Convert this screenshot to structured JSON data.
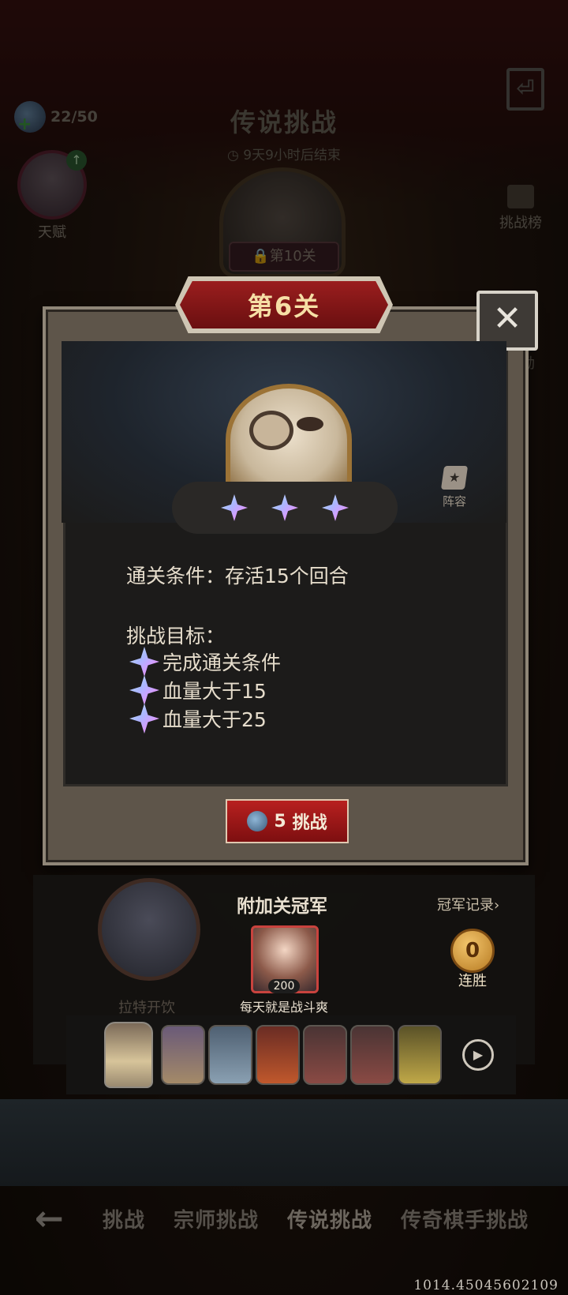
{
  "header": {
    "title": "传说挑战",
    "timer": "9天9小时后结束",
    "stamina": "22/50",
    "talent_label": "天赋",
    "side_menu": [
      "挑战榜",
      "奖励"
    ],
    "bg_stage_label": "第10关"
  },
  "modal": {
    "title": "第6关",
    "close_icon": "close-icon",
    "stars_earned": 3,
    "lineup_label": "阵容",
    "condition": "通关条件：存活15个回合",
    "goal_title": "挑战目标：",
    "goals": [
      "完成通关条件",
      "血量大于15",
      "血量大于25"
    ],
    "challenge_cost": "5",
    "challenge_label": "挑战"
  },
  "champion": {
    "title": "附加关冠军",
    "record_link": "冠军记录›",
    "level": "200",
    "name": "每天就是战斗爽",
    "streak_count": "0",
    "streak_label": "连胜",
    "bg_hero_label": "拉特开饮"
  },
  "bottom_nav": {
    "back_icon": "back-arrow-icon",
    "tabs": [
      "挑战",
      "宗师挑战",
      "传说挑战",
      "传奇棋手挑战"
    ]
  },
  "debug": {
    "coords": "1014.45045602109"
  },
  "colors": {
    "accent_red": "#9a1e1e",
    "gold": "#f6dfa6"
  }
}
